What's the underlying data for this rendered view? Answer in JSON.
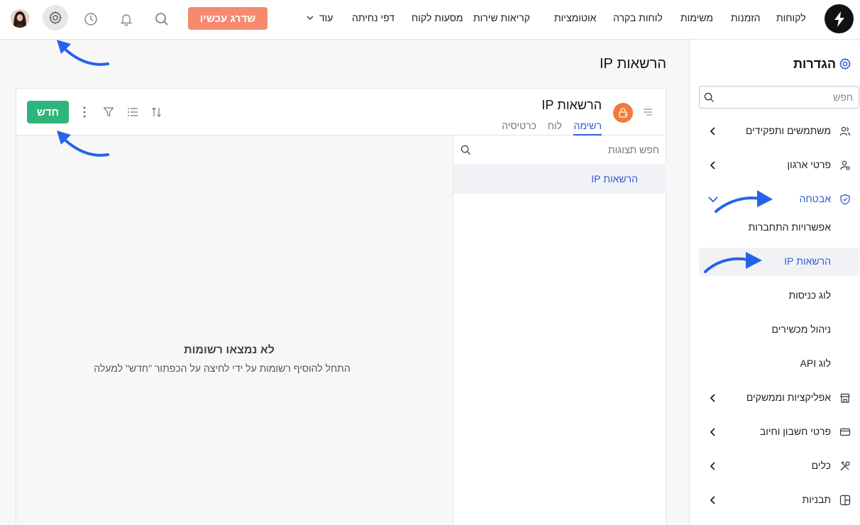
{
  "topbar": {
    "nav": [
      "לקוחות",
      "הזמנות",
      "משימות",
      "לוחות בקרה",
      "אוטומציות",
      "קריאות שירות",
      "מסעות לקוח",
      "דפי נחיתה"
    ],
    "more_label": "עוד",
    "upgrade_label": "שדרג עכשיו"
  },
  "sidebar": {
    "title": "הגדרות",
    "search_placeholder": "חפש",
    "items": [
      {
        "label": "משתמשים ותפקידים",
        "icon": "users-icon"
      },
      {
        "label": "פרטי ארגון",
        "icon": "org-icon"
      },
      {
        "label": "אבטחה",
        "icon": "shield-icon"
      },
      {
        "label": "אפליקציות וממשקים",
        "icon": "store-icon"
      },
      {
        "label": "פרטי חשבון וחיוב",
        "icon": "card-icon"
      },
      {
        "label": "כלים",
        "icon": "tools-icon"
      },
      {
        "label": "תבניות",
        "icon": "templates-icon"
      }
    ],
    "security_sub": [
      "אפשרויות התחברות",
      "הרשאות IP",
      "לוג כניסות",
      "ניהול מכשירים",
      "לוג API"
    ]
  },
  "main": {
    "page_title": "הרשאות IP",
    "view_title": "הרשאות IP",
    "tabs": [
      "רשימה",
      "לוח",
      "כרטיסיה"
    ],
    "new_label": "חדש",
    "list_search_placeholder": "חפש תצוגות",
    "list_item": "הרשאות IP",
    "empty_title": "לא נמצאו רשומות",
    "empty_subtitle": "התחל להוסיף רשומות על ידי לחיצה על הכפתור \"חדש\" למעלה"
  },
  "colors": {
    "accent": "#2f5bd6",
    "upgrade": "#f58a6e",
    "new_button": "#2fb47c",
    "badge": "#f27b3c",
    "annotation_arrow": "#2563eb"
  }
}
